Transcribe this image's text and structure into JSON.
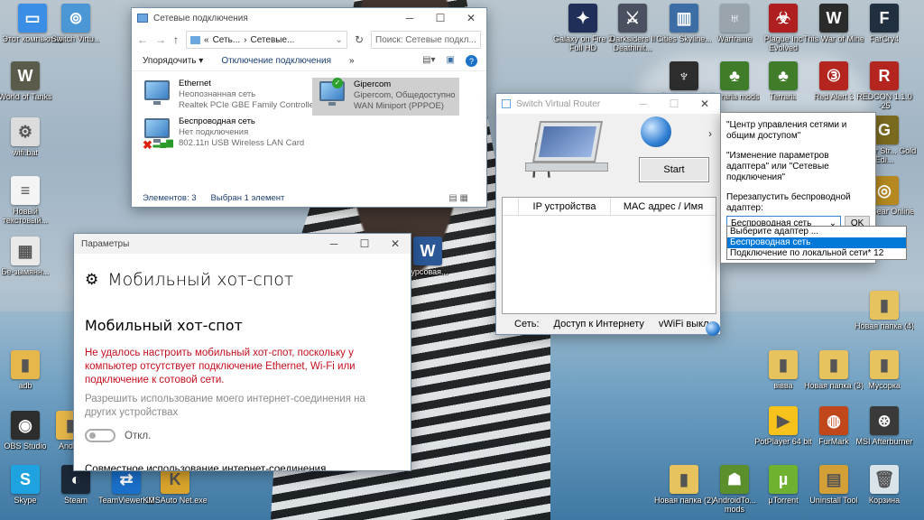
{
  "desktop_icons": [
    {
      "label": "Этот компьютер",
      "color": "#3a8ee6",
      "glyph": "▭"
    },
    {
      "label": "Switch Virtu...",
      "color": "#4b97d6",
      "glyph": "⊚"
    },
    {
      "label": "World of Tanks",
      "color": "#5b5b4c",
      "glyph": "W"
    },
    {
      "label": "wifi.bat",
      "color": "#dcdcdc",
      "glyph": "⚙"
    },
    {
      "label": "Новый текстовый...",
      "color": "#f4f4f4",
      "glyph": "≡"
    },
    {
      "label": "Бе-зымянн...",
      "color": "#e9e9e9",
      "glyph": "▦"
    },
    {
      "label": "adb",
      "color": "#e6b74a",
      "glyph": "▮"
    },
    {
      "label": "OBS Studio",
      "color": "#2d2d2d",
      "glyph": "◉"
    },
    {
      "label": "Andr...",
      "color": "#e6b74a",
      "glyph": "▮"
    },
    {
      "label": "Skype",
      "color": "#1fa3e0",
      "glyph": "S"
    },
    {
      "label": "Steam",
      "color": "#1b2838",
      "glyph": "◐"
    },
    {
      "label": "TeamViewer 12",
      "color": "#1a6fc9",
      "glyph": "⇄"
    },
    {
      "label": "KMSAuto Net.exe",
      "color": "#d9a42c",
      "glyph": "K"
    },
    {
      "label": "курсовая...",
      "color": "#2b5797",
      "glyph": "W"
    },
    {
      "label": "Galaxy on Fire 2 Full HD",
      "color": "#1f2f5a",
      "glyph": "✦"
    },
    {
      "label": "Darksiders II Deathinit...",
      "color": "#4a5060",
      "glyph": "⚔"
    },
    {
      "label": "Cities Skyline...",
      "color": "#3c6ea5",
      "glyph": "▥"
    },
    {
      "label": "Warframe",
      "color": "#9aa4ad",
      "glyph": "♅"
    },
    {
      "label": "Plague Inc Evolved",
      "color": "#b01f1f",
      "glyph": "☣"
    },
    {
      "label": "This War of Mine",
      "color": "#2b2b2b",
      "glyph": "W"
    },
    {
      "label": "FarCry4",
      "color": "#203040",
      "glyph": "F"
    },
    {
      "label": "Darksiders II",
      "color": "#2d2d2d",
      "glyph": "♆"
    },
    {
      "label": "Terraria mods",
      "color": "#3f7d2a",
      "glyph": "♣"
    },
    {
      "label": "Terraria",
      "color": "#3f7d2a",
      "glyph": "♣"
    },
    {
      "label": "Red Alert 3",
      "color": "#b3251e",
      "glyph": "③"
    },
    {
      "label": "REDCON 1.1.0 -25",
      "color": "#b3251e",
      "glyph": "R"
    },
    {
      "label": "...anter Str... Gold Edi...",
      "color": "#7a6a20",
      "glyph": "G"
    },
    {
      "label": "...arspear Online",
      "color": "#b5891f",
      "glyph": "◎"
    },
    {
      "label": "Новая папка (4)",
      "color": "#e6c35c",
      "glyph": "▮"
    },
    {
      "label": "вівва",
      "color": "#e6c35c",
      "glyph": "▮"
    },
    {
      "label": "Новая папка (3)",
      "color": "#e6c35c",
      "glyph": "▮"
    },
    {
      "label": "Мусорка",
      "color": "#e6c35c",
      "glyph": "▮"
    },
    {
      "label": "PotPlayer 64 bit",
      "color": "#f6c21b",
      "glyph": "▶"
    },
    {
      "label": "FurMark",
      "color": "#c0471c",
      "glyph": "◍"
    },
    {
      "label": "MSI Afterburner",
      "color": "#3a3a3a",
      "glyph": "⊛"
    },
    {
      "label": "Новая папка (2)",
      "color": "#e6c35c",
      "glyph": "▮"
    },
    {
      "label": "AndroidTo... mods",
      "color": "#5a8f2c",
      "glyph": "☗"
    },
    {
      "label": "µTorrent",
      "color": "#6fb130",
      "glyph": "µ"
    },
    {
      "label": "Uninstall Tool",
      "color": "#d2a036",
      "glyph": "▤"
    },
    {
      "label": "Корзина",
      "color": "#d8e3ea",
      "glyph": "🗑"
    }
  ],
  "netwin": {
    "title": "Сетевые подключения",
    "nav_glyphs": [
      "←",
      "→",
      "↑"
    ],
    "path_prefix": "«",
    "path_1": "Сеть...",
    "path_2": "Сетевые...",
    "search_placeholder": "Поиск: Сетевые подкл...",
    "cmd_organize": "Упорядочить ▾",
    "cmd_disable": "Отключение подключения",
    "cmd_more": "»",
    "connections": [
      {
        "name": "Ethernet",
        "status": "Неопознанная сеть",
        "device": "Realtek PCIe GBE Family Controller"
      },
      {
        "name": "Беспроводная сеть",
        "status": "Нет подключения",
        "device": "802.11n USB Wireless LAN Card"
      },
      {
        "name": "Gipercom",
        "status": "Gipercom, Общедоступно",
        "device": "WAN Miniport (PPPOE)"
      }
    ],
    "status_count": "Элементов: 3",
    "status_selected": "Выбран 1 элемент"
  },
  "setwin": {
    "title": "Параметры",
    "heading": "Мобильный хот-спот",
    "subheading": "Мобильный хот-спот",
    "error": "Не удалось настроить мобильный хот-спот, поскольку у компьютер отсутствует подключение Ethernet, Wi-Fi или подключение к сотовой сети.",
    "share_desc": "Разрешить использование моего интернет-соединения на других устройствах",
    "toggle_state": "Откл.",
    "share_title": "Совместное использование интернет-соединения"
  },
  "svrwin": {
    "title": "Switch Virtual Router",
    "start": "Start",
    "col_ip": "IP устройства",
    "col_mac": "MAC адрес / Имя",
    "status_net": "Сеть:",
    "status_inet": "Доступ к Интернету",
    "status_vwifi": "vWiFi выкл"
  },
  "tip": {
    "line1": "\"Центр управления сетями и общим доступом\"",
    "line2": "\"Изменение параметров адаптера\" или \"Сетевые подключения\"",
    "line3": "Перезапустить беспроводной адаптер:",
    "selected": "Беспроводная сеть",
    "ok": "OK",
    "options": [
      "Выберите адаптер ...",
      "Беспроводная сеть",
      "Подключение по локальной сети* 12"
    ],
    "highlighted_index": 1
  },
  "colors": {
    "error": "#c50f1f",
    "link": "#1a3e72",
    "accent": "#0078d7"
  }
}
